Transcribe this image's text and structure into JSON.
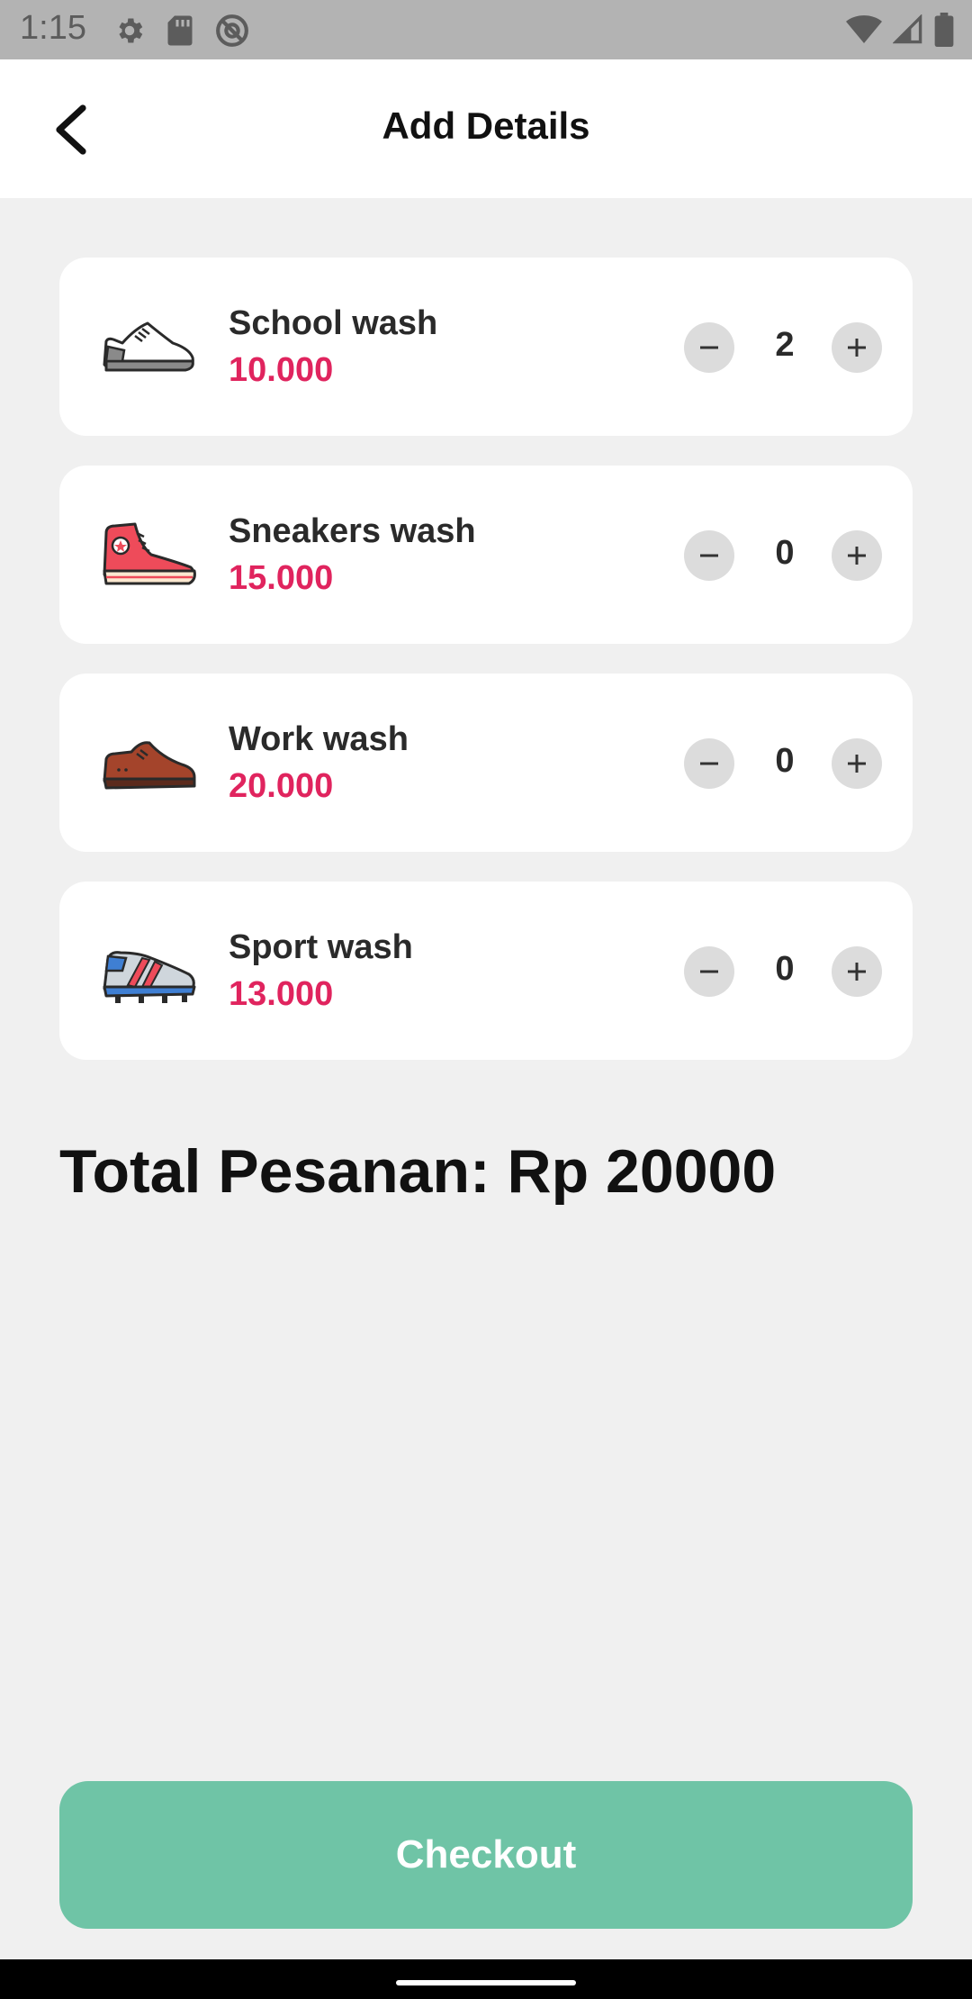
{
  "status_bar": {
    "time": "1:15",
    "left_icons": [
      "settings-icon",
      "sd-card-icon",
      "do-not-disturb-icon"
    ],
    "right_icons": [
      "wifi-icon",
      "cell-signal-icon",
      "battery-icon"
    ]
  },
  "app_bar": {
    "title": "Add Details",
    "back_icon": "arrow-back-icon"
  },
  "items": [
    {
      "name": "School wash",
      "price": "10.000",
      "qty": "2",
      "icon": "school-shoe-icon"
    },
    {
      "name": "Sneakers wash",
      "price": "15.000",
      "qty": "0",
      "icon": "sneaker-icon"
    },
    {
      "name": "Work wash",
      "price": "20.000",
      "qty": "0",
      "icon": "work-shoe-icon"
    },
    {
      "name": "Sport wash",
      "price": "13.000",
      "qty": "0",
      "icon": "sport-shoe-icon"
    }
  ],
  "total_label": "Total Pesanan: Rp 20000",
  "checkout_label": "Checkout",
  "colors": {
    "price": "#e0245e",
    "checkout": "#6fc4a6",
    "background": "#f0f0f0",
    "card": "#ffffff"
  }
}
